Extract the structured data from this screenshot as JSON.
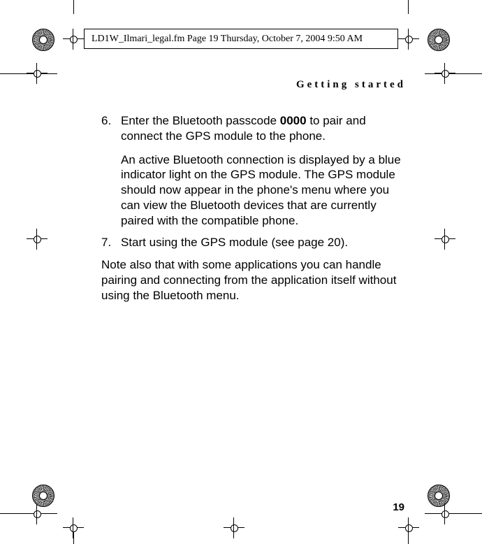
{
  "header": {
    "file_info": "LD1W_Ilmari_legal.fm  Page 19  Thursday, October 7, 2004  9:50 AM"
  },
  "section_title": "Getting started",
  "steps": {
    "s6": {
      "num": "6.",
      "text_pre": "Enter the Bluetooth passcode ",
      "code": "0000",
      "text_post": " to pair and connect the GPS module to the phone.",
      "sub": "An active Bluetooth connection is displayed by a blue indicator light on the GPS module. The GPS module should now appear in the phone's menu where you can view the Bluetooth devices that are currently paired with the compatible phone."
    },
    "s7": {
      "num": "7.",
      "text": "Start using the GPS module (see page 20)."
    }
  },
  "note": "Note also that with some applications you can handle pairing and connecting from the application itself without using the Bluetooth menu.",
  "page_number": "19"
}
